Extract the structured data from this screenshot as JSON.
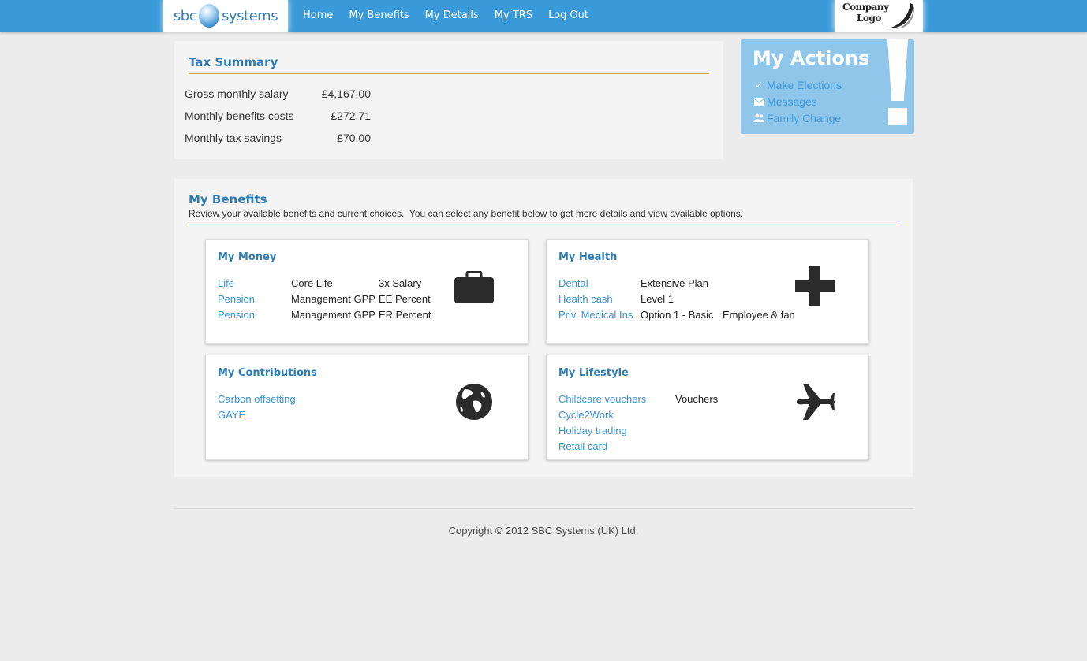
{
  "brand": {
    "left": "sbc",
    "right": "systems"
  },
  "nav": [
    "Home",
    "My Benefits",
    "My Details",
    "My TRS",
    "Log Out"
  ],
  "company_logo": {
    "line1": "Company",
    "line2": "Logo"
  },
  "tax_summary": {
    "title": "Tax Summary",
    "rows": [
      {
        "label": "Gross monthly salary",
        "value": "£4,167.00"
      },
      {
        "label": "Monthly benefits costs",
        "value": "£272.71"
      },
      {
        "label": "Monthly tax savings",
        "value": "£70.00"
      }
    ]
  },
  "actions": {
    "title": "My Actions",
    "items": [
      {
        "label": "Make Elections",
        "icon": "checkmark-icon"
      },
      {
        "label": "Messages",
        "icon": "envelope-icon"
      },
      {
        "label": "Family Change",
        "icon": "people-icon"
      }
    ]
  },
  "benefits": {
    "title": "My Benefits",
    "subtitle": "Review your available benefits and current choices.  You can select any benefit below to get more details and view available options.",
    "cards": {
      "money": {
        "title": "My Money",
        "icon": "briefcase-icon",
        "rows": [
          {
            "name": "Life",
            "plan": "Core Life",
            "option": "3x Salary"
          },
          {
            "name": "Pension",
            "plan": "Management GPP",
            "option": "EE Percent"
          },
          {
            "name": "Pension",
            "plan": "Management GPP",
            "option": "ER Percent"
          }
        ]
      },
      "health": {
        "title": "My Health",
        "icon": "plus-icon",
        "rows": [
          {
            "name": "Dental",
            "plan": "Extensive Plan",
            "option": ""
          },
          {
            "name": "Health cash",
            "plan": "Level 1",
            "option": ""
          },
          {
            "name": "Priv. Medical Ins",
            "plan": "Option 1 - Basic",
            "option": "Employee & fan"
          }
        ]
      },
      "contributions": {
        "title": "My Contributions",
        "icon": "globe-icon",
        "rows": [
          {
            "name": "Carbon offsetting"
          },
          {
            "name": "GAYE"
          }
        ]
      },
      "lifestyle": {
        "title": "My Lifestyle",
        "icon": "airplane-icon",
        "rows": [
          {
            "name": "Childcare vouchers",
            "plan": "Vouchers"
          },
          {
            "name": "Cycle2Work",
            "plan": ""
          },
          {
            "name": "Holiday trading",
            "plan": ""
          },
          {
            "name": "Retail card",
            "plan": ""
          }
        ]
      }
    }
  },
  "footer": "Copyright © 2012 SBC Systems (UK) Ltd."
}
